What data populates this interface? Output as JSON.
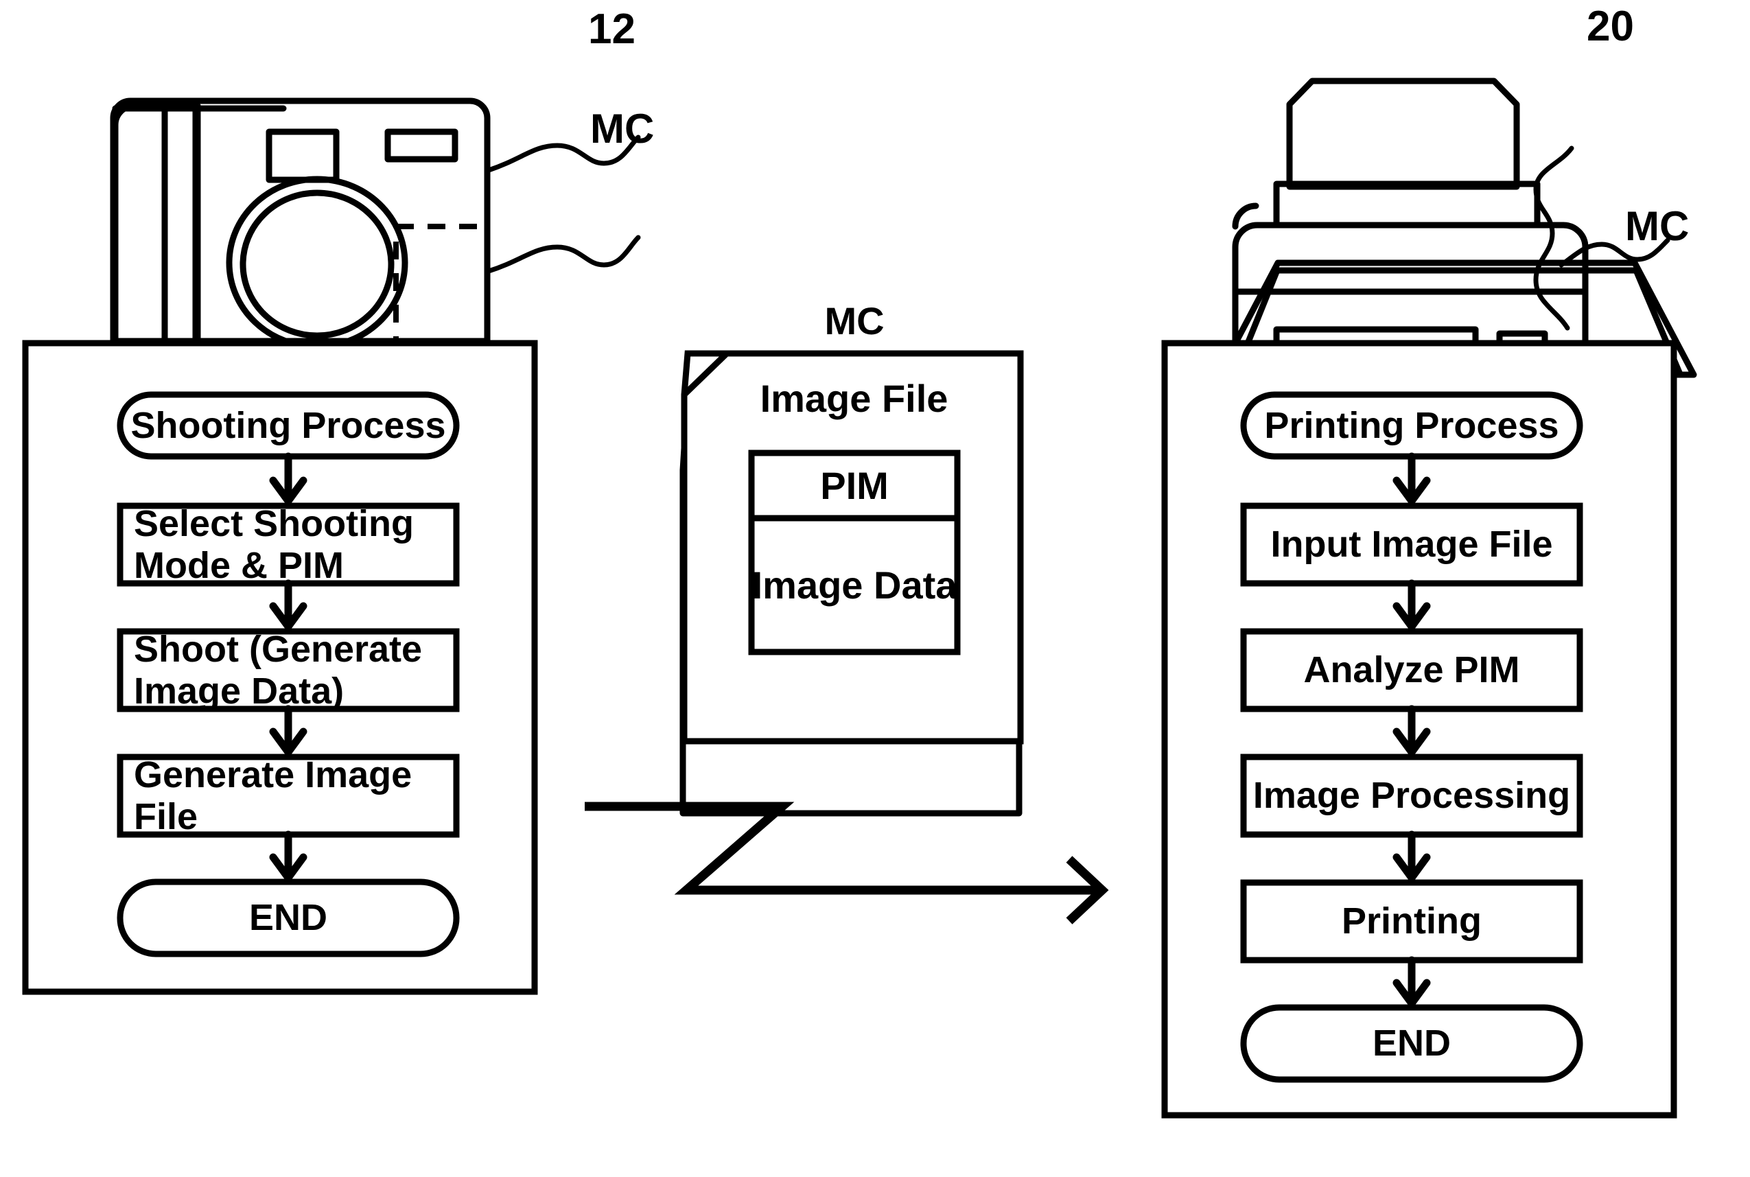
{
  "figure": {
    "kind": "patent-flow-diagram",
    "background_color": "#ffffff",
    "line_color": "#000000"
  },
  "camera": {
    "reference_numeral": "12",
    "memory_card_label": "MC",
    "parts": [
      "grip",
      "viewfinder-window",
      "flash-window",
      "lens",
      "memory-card-slot"
    ]
  },
  "printer": {
    "reference_numeral": "20",
    "memory_card_label": "MC",
    "parts": [
      "paper-tray-top",
      "lid",
      "body",
      "output-slot",
      "card-slot",
      "stand"
    ]
  },
  "memory_card": {
    "label": "MC",
    "title": "Image File",
    "sections": [
      {
        "name": "PIM"
      },
      {
        "name": "Image Data"
      }
    ]
  },
  "shooting_flow": {
    "start": "Shooting Process",
    "steps": [
      "Select Shooting Mode\n& PIM",
      "Shoot\n(Generate Image Data)",
      "Generate Image File"
    ],
    "end": "END"
  },
  "printing_flow": {
    "start": "Printing Process",
    "steps": [
      "Input Image File",
      "Analyze PIM",
      "Image Processing",
      "Printing"
    ],
    "end": "END"
  },
  "transfer_arrow": {
    "style": "zigzag-break-arrow",
    "direction": "left-to-right"
  }
}
